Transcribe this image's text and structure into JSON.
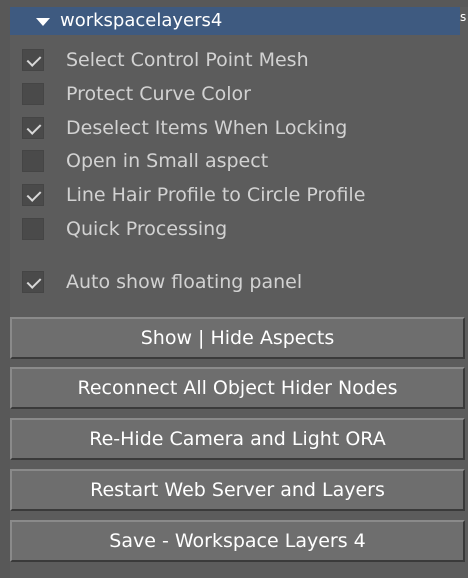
{
  "panel": {
    "title": "workspacelayers4",
    "edge_char": "s"
  },
  "options": [
    {
      "label": "Select Control Point Mesh",
      "checked": true
    },
    {
      "label": "Protect Curve Color",
      "checked": false
    },
    {
      "label": "Deselect Items When Locking",
      "checked": true
    },
    {
      "label": "Open in Small aspect",
      "checked": false
    },
    {
      "label": "Line Hair Profile to Circle Profile",
      "checked": true
    },
    {
      "label": "Quick Processing",
      "checked": false
    },
    {
      "label": "Auto show floating panel",
      "checked": true
    }
  ],
  "buttons": [
    {
      "label": "Show | Hide Aspects"
    },
    {
      "label": "Reconnect All Object Hider Nodes"
    },
    {
      "label": "Re-Hide Camera and Light ORA"
    },
    {
      "label": "Restart Web Server and Layers"
    },
    {
      "label": "Save - Workspace Layers 4"
    }
  ],
  "colors": {
    "header_bg": "#3e5a80",
    "panel_bg": "#5c5c5c",
    "button_bg": "#6e6e6e"
  }
}
